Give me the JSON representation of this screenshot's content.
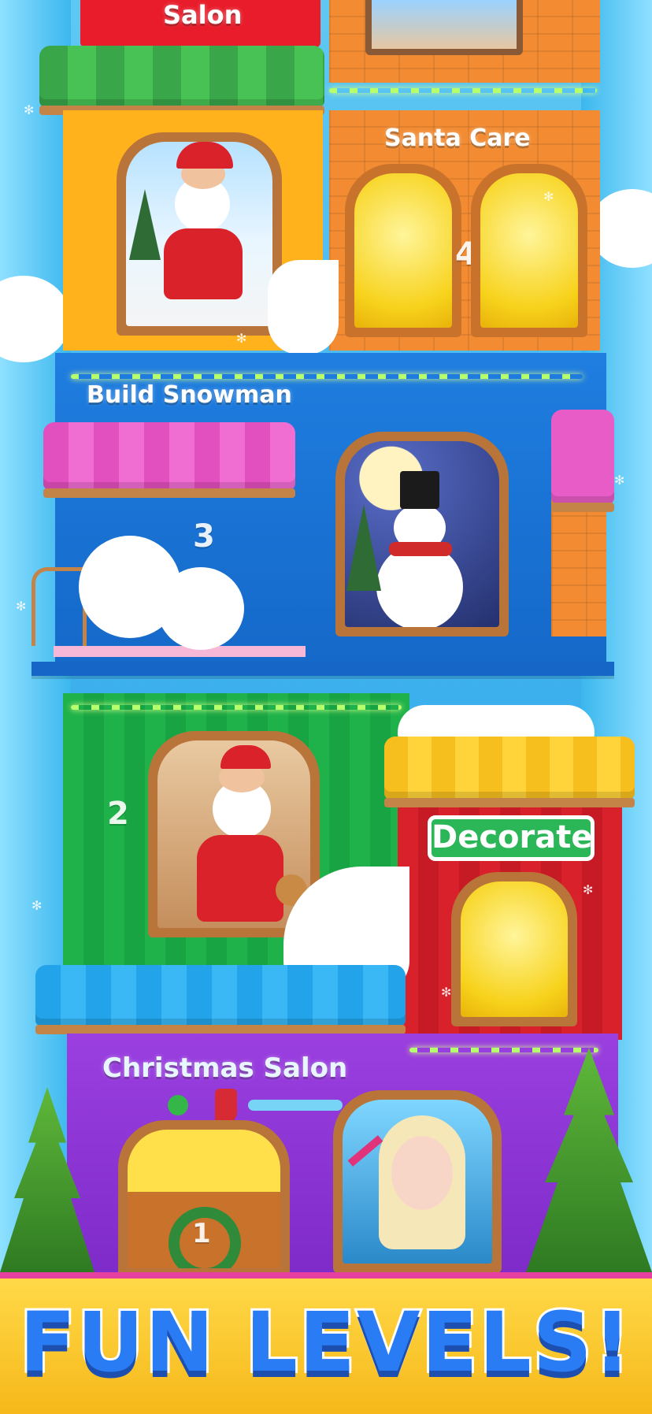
{
  "levels": [
    {
      "number": "4",
      "title": "Santa Care"
    },
    {
      "number": "3",
      "title": "Build Snowman"
    },
    {
      "number": "2",
      "title": "Decorate"
    },
    {
      "number": "1",
      "title": "Christmas Salon"
    }
  ],
  "top_partial_label": "Salon",
  "banner": {
    "text": "FUN LEVELS!"
  },
  "colors": {
    "banner_text": "#2a7cf4",
    "banner_bg": "#f6b81a",
    "banner_border": "#e73fa0",
    "sky": "#3fb3ee"
  },
  "icons": [
    "snowflake-icon",
    "santa-character",
    "snowman-character",
    "princess-character",
    "christmas-tree",
    "wreath-icon",
    "christmas-stocking-icon"
  ]
}
